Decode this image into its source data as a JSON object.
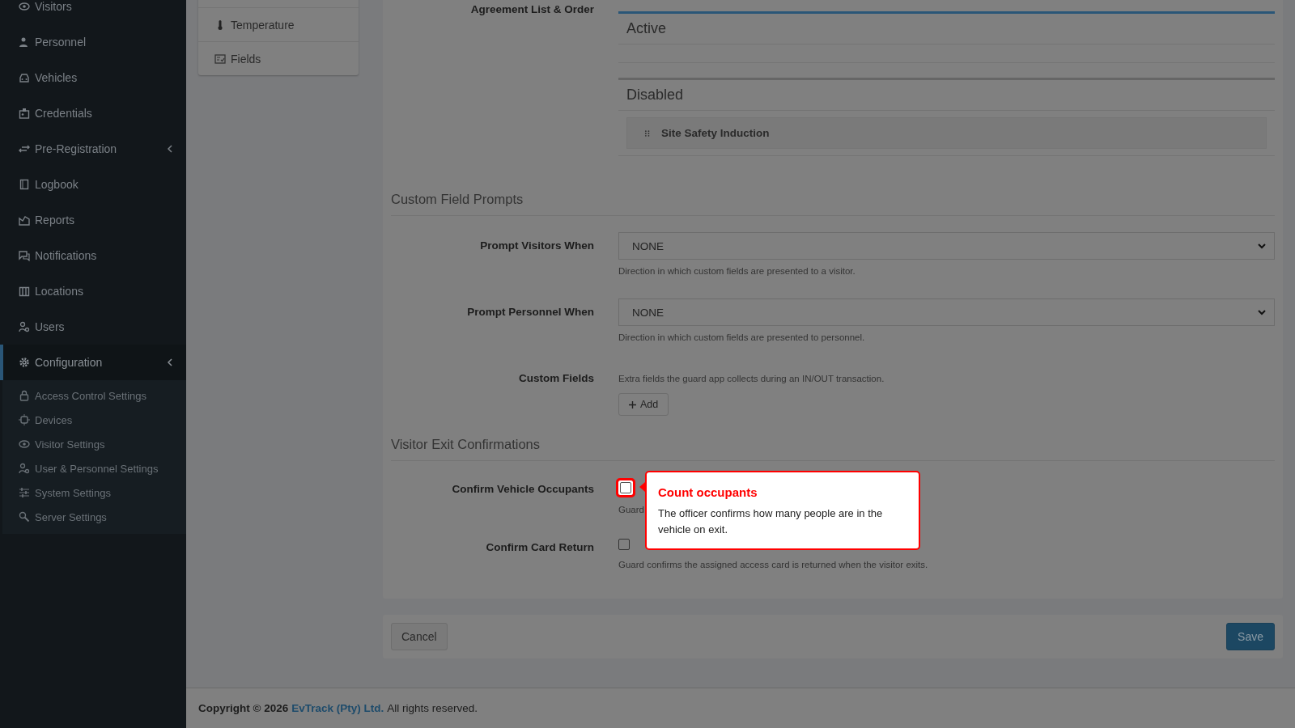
{
  "sidebar": {
    "items": [
      {
        "label": "Visitors",
        "selected": false,
        "has_submenu": false
      },
      {
        "label": "Personnel",
        "selected": false,
        "has_submenu": false
      },
      {
        "label": "Vehicles",
        "selected": false,
        "has_submenu": false
      },
      {
        "label": "Credentials",
        "selected": false,
        "has_submenu": false
      },
      {
        "label": "Pre-Registration",
        "selected": false,
        "has_submenu": true
      },
      {
        "label": "Logbook",
        "selected": false,
        "has_submenu": false
      },
      {
        "label": "Reports",
        "selected": false,
        "has_submenu": false
      },
      {
        "label": "Notifications",
        "selected": false,
        "has_submenu": false
      },
      {
        "label": "Locations",
        "selected": false,
        "has_submenu": false
      },
      {
        "label": "Users",
        "selected": false,
        "has_submenu": false
      },
      {
        "label": "Configuration",
        "selected": true,
        "has_submenu": true,
        "children": [
          {
            "label": "Access Control Settings"
          },
          {
            "label": "Devices"
          },
          {
            "label": "Visitor Settings"
          },
          {
            "label": "User & Personnel Settings"
          },
          {
            "label": "System Settings"
          },
          {
            "label": "Server Settings"
          }
        ]
      }
    ]
  },
  "section_tabs": [
    {
      "label": "Temperature",
      "selected": false
    },
    {
      "label": "Fields",
      "selected": false
    }
  ],
  "agreements": {
    "label": "Agreement List & Order",
    "panels": [
      {
        "title": "Active",
        "kind": "active"
      },
      {
        "title": "Disabled",
        "kind": "disabled",
        "items": [
          "Site Safety Induction"
        ]
      }
    ]
  },
  "sections": [
    {
      "heading": "Custom Field Prompts",
      "rows": [
        {
          "kind": "select",
          "label": "Prompt Visitors When",
          "value": "NONE",
          "help": "Direction in which custom fields are presented to a visitor."
        },
        {
          "kind": "select",
          "label": "Prompt Personnel When",
          "value": "NONE",
          "help": "Direction in which custom fields are presented to personnel."
        },
        {
          "kind": "add",
          "label": "Custom Fields",
          "help": "Extra fields the guard app collects during an IN/OUT transaction.",
          "button": "Add"
        }
      ]
    },
    {
      "heading": "Visitor Exit Confirmations",
      "rows": [
        {
          "kind": "checkbox",
          "label": "Confirm Vehicle Occupants",
          "checked": false,
          "highlighted": true,
          "help": "Guard"
        },
        {
          "kind": "checkbox",
          "label": "Confirm Card Return",
          "checked": false,
          "highlighted": false,
          "help": "Guard confirms the assigned access card is returned when the visitor exits."
        }
      ]
    }
  ],
  "tooltip": {
    "title": "Count occupants",
    "text": "The officer confirms how many people are in the vehicle on exit."
  },
  "buttons": {
    "cancel": "Cancel",
    "save": "Save"
  },
  "footer": {
    "prefix": "Copyright © 2026",
    "link": "EvTrack (Pty) Ltd.",
    "suffix": "All rights reserved."
  }
}
